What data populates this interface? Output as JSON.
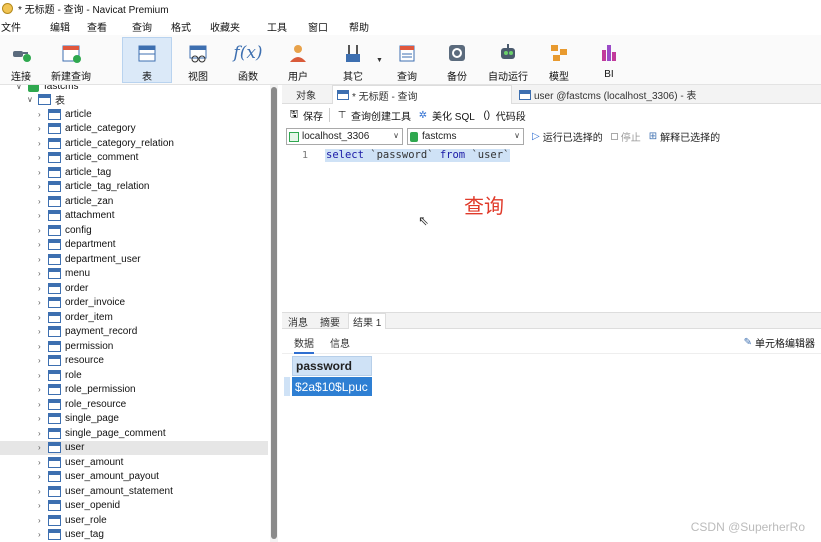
{
  "window": {
    "title": "* 无标题 - 查询 - Navicat Premium"
  },
  "menu": [
    "文件",
    "编辑",
    "查看",
    "查询",
    "格式",
    "收藏夹",
    "工具",
    "窗口",
    "帮助"
  ],
  "toolbar": [
    {
      "label": "连接",
      "icon": "plug-icon"
    },
    {
      "label": "新建查询",
      "icon": "new-query-icon"
    },
    {
      "label": "表",
      "icon": "table-icon"
    },
    {
      "label": "视图",
      "icon": "view-icon"
    },
    {
      "label": "函数",
      "icon": "function-icon"
    },
    {
      "label": "用户",
      "icon": "user-icon"
    },
    {
      "label": "其它",
      "icon": "tools-icon"
    },
    {
      "label": "查询",
      "icon": "query-icon"
    },
    {
      "label": "备份",
      "icon": "backup-icon"
    },
    {
      "label": "自动运行",
      "icon": "robot-icon"
    },
    {
      "label": "模型",
      "icon": "model-icon"
    },
    {
      "label": "BI",
      "icon": "bi-icon"
    }
  ],
  "tree": {
    "db": "fastcms",
    "group": "表",
    "items": [
      "article",
      "article_category",
      "article_category_relation",
      "article_comment",
      "article_tag",
      "article_tag_relation",
      "article_zan",
      "attachment",
      "config",
      "department",
      "department_user",
      "menu",
      "order",
      "order_invoice",
      "order_item",
      "payment_record",
      "permission",
      "resource",
      "role",
      "role_permission",
      "role_resource",
      "single_page",
      "single_page_comment",
      "user",
      "user_amount",
      "user_amount_payout",
      "user_amount_statement",
      "user_openid",
      "user_role",
      "user_tag"
    ],
    "selected": "user"
  },
  "tabs": [
    {
      "label": "对象"
    },
    {
      "label": "* 无标题 - 查询"
    },
    {
      "label": "user @fastcms (localhost_3306) - 表"
    }
  ],
  "query_toolbar": {
    "save": "保存",
    "builder": "查询创建工具",
    "beautify": "美化 SQL",
    "snippet": "代码段"
  },
  "connection": {
    "server": "localhost_3306",
    "database": "fastcms",
    "run": "运行已选择的",
    "stop": "停止",
    "explain": "解释已选择的"
  },
  "editor": {
    "line": "1",
    "kw1": "select",
    "col": "`password`",
    "kw2": "from",
    "tbl": "`user`",
    "annotation": "查询"
  },
  "result_tabs": [
    "消息",
    "摘要",
    "结果 1"
  ],
  "sub_tabs": [
    "数据",
    "信息"
  ],
  "cell_editor": "单元格编辑器",
  "grid": {
    "column": "password",
    "value": "$2a$10$Lpuc"
  },
  "watermark": "CSDN @SuperherRo",
  "colors": {
    "accent": "#2e7fd3",
    "annotation": "#e03a2a",
    "selection": "#cfe2f6"
  }
}
